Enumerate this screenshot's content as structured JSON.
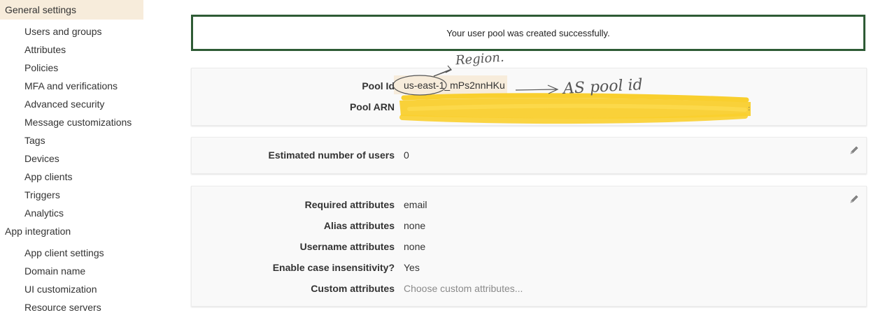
{
  "sidebar": {
    "sections": [
      {
        "label": "General settings",
        "items": [
          "Users and groups",
          "Attributes",
          "Policies",
          "MFA and verifications",
          "Advanced security",
          "Message customizations",
          "Tags",
          "Devices",
          "App clients",
          "Triggers",
          "Analytics"
        ]
      },
      {
        "label": "App integration",
        "items": [
          "App client settings",
          "Domain name",
          "UI customization",
          "Resource servers"
        ]
      }
    ]
  },
  "banner": {
    "message": "Your user pool was created successfully."
  },
  "pool": {
    "id_label": "Pool Id",
    "id_value": "us-east-1_mPs2nnHKu",
    "arn_label": "Pool ARN"
  },
  "users": {
    "label": "Estimated number of users",
    "value": "0"
  },
  "attributes": {
    "rows": [
      {
        "label": "Required attributes",
        "value": "email"
      },
      {
        "label": "Alias attributes",
        "value": "none"
      },
      {
        "label": "Username attributes",
        "value": "none"
      },
      {
        "label": "Enable case insensitivity?",
        "value": "Yes"
      },
      {
        "label": "Custom attributes",
        "value": "Choose custom attributes..."
      }
    ]
  },
  "annotations": {
    "region_note": "Region.",
    "pool_id_note": "AS pool id"
  },
  "colors": {
    "active_section_bg": "#f7ecdb",
    "banner_border": "#2e5b35",
    "panel_bg": "#f9f9f9",
    "redaction": "#f9cf2e"
  }
}
